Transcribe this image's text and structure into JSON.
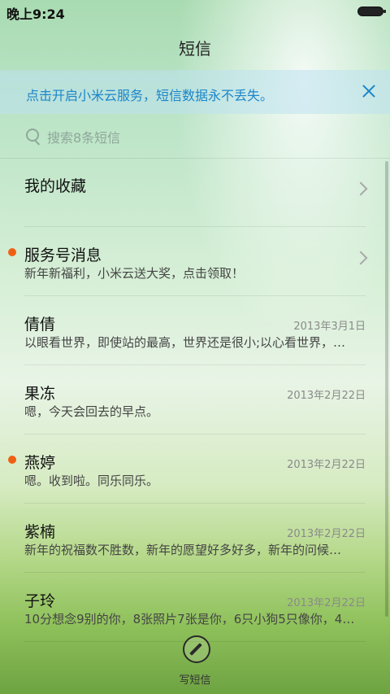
{
  "status": {
    "time": "晚上9:24"
  },
  "header": {
    "title": "短信"
  },
  "banner": {
    "text": "点击开启小米云服务，短信数据永不丢失。"
  },
  "search": {
    "placeholder": "搜索8条短信"
  },
  "conversations": [
    {
      "title": "我的收藏",
      "subtitle": "",
      "date": "",
      "unread": false,
      "chevron": true
    },
    {
      "title": "服务号消息",
      "subtitle": "新年新福利，小米云送大奖，点击领取！",
      "date": "",
      "unread": true,
      "chevron": true
    },
    {
      "title": "倩倩",
      "subtitle": "以眼看世界，即使站的最高，世界还是很小;以心看世界，…",
      "date": "2013年3月1日",
      "unread": false,
      "chevron": false
    },
    {
      "title": "果冻",
      "subtitle": "嗯，今天会回去的早点。",
      "date": "2013年2月22日",
      "unread": false,
      "chevron": false
    },
    {
      "title": "燕婷",
      "subtitle": "嗯。收到啦。同乐同乐。",
      "date": "2013年2月22日",
      "unread": true,
      "chevron": false
    },
    {
      "title": "紫楠",
      "subtitle": "新年的祝福数不胜数，新年的愿望好多好多，新年的问候…",
      "date": "2013年2月22日",
      "unread": false,
      "chevron": false
    },
    {
      "title": "子玲",
      "subtitle": "10分想念9别的你，8张照片7张是你，6只小狗5只像你，4…",
      "date": "2013年2月22日",
      "unread": false,
      "chevron": false
    }
  ],
  "compose": {
    "label": "写短信"
  },
  "colors": {
    "unread_dot": "#f06014",
    "banner_text": "#1c86c9"
  }
}
